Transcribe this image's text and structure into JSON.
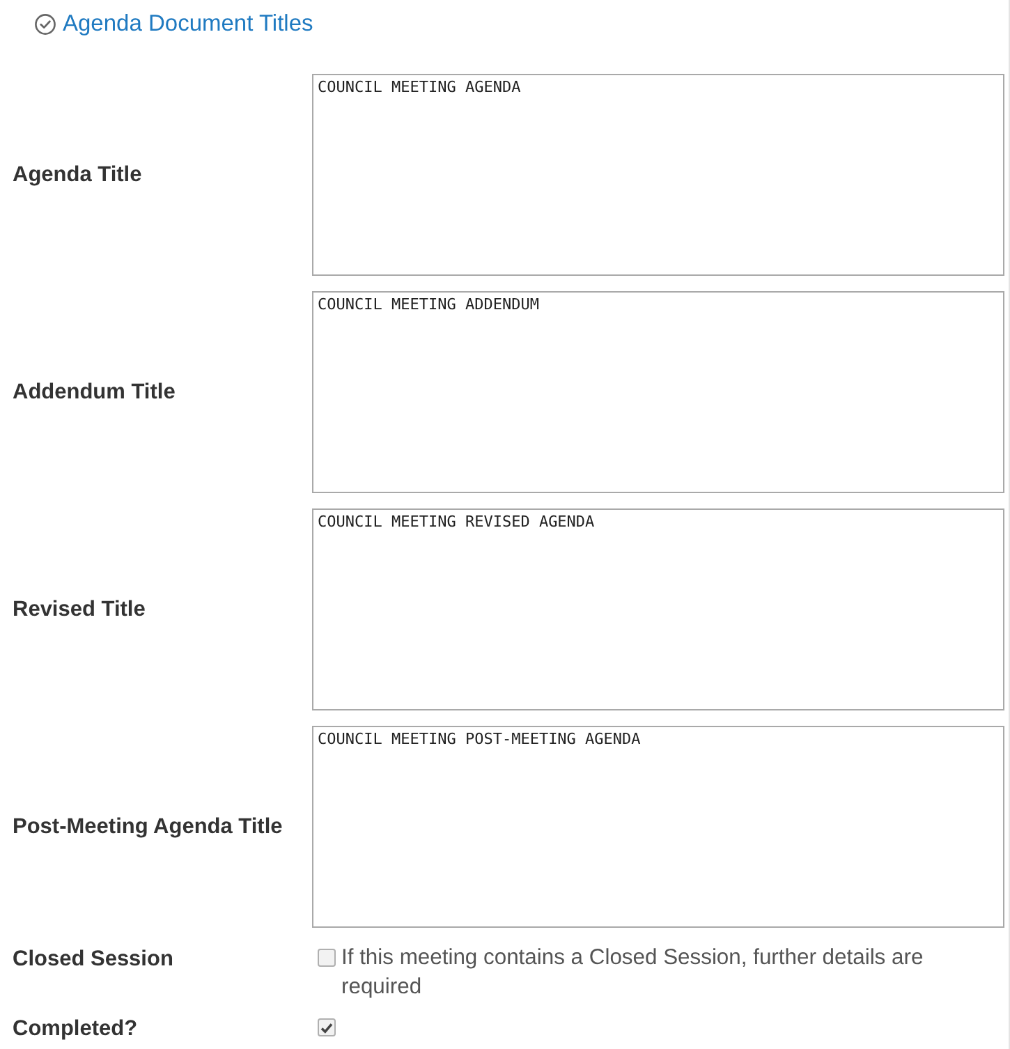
{
  "section": {
    "title": "Agenda Document Titles"
  },
  "fields": [
    {
      "kind": "textarea",
      "label": "Agenda Title",
      "value": "COUNCIL MEETING AGENDA"
    },
    {
      "kind": "textarea",
      "label": "Addendum Title",
      "value": "COUNCIL MEETING ADDENDUM"
    },
    {
      "kind": "textarea",
      "label": "Revised Title",
      "value": "COUNCIL MEETING REVISED AGENDA"
    },
    {
      "kind": "textarea",
      "label": "Post-Meeting Agenda Title",
      "value": "COUNCIL MEETING POST-MEETING AGENDA"
    },
    {
      "kind": "checkbox",
      "label": "Closed Session",
      "checked": false,
      "text": "If this meeting contains a Closed Session, further details are required"
    },
    {
      "kind": "checkbox",
      "label": "Completed?",
      "checked": true
    }
  ]
}
